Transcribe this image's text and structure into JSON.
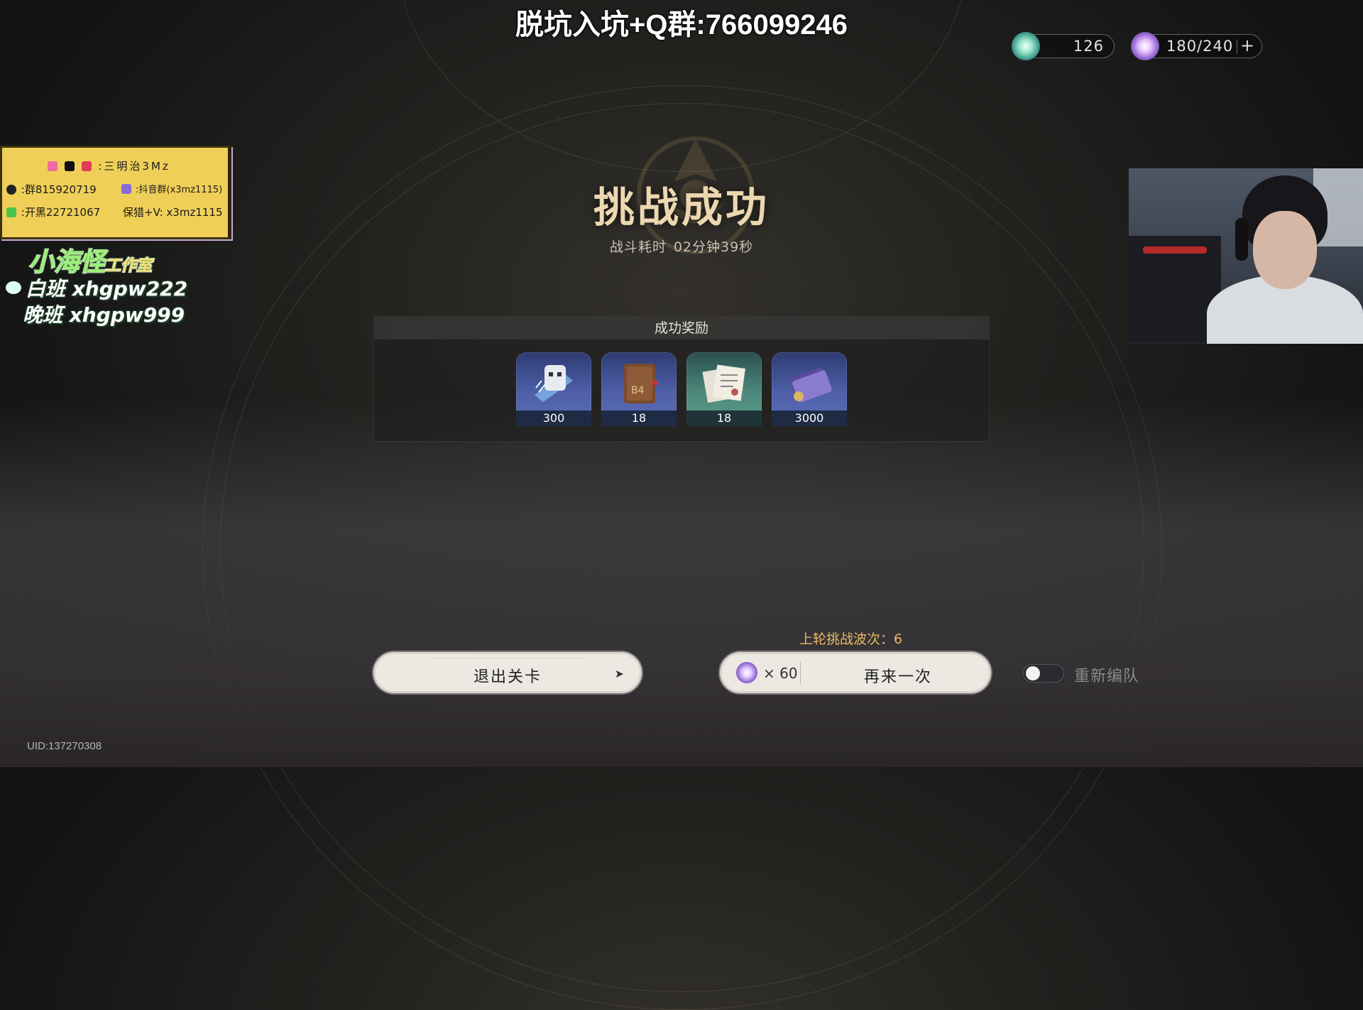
{
  "watermark": "脱坑入坑+Q群:766099246",
  "resources": {
    "fuel": {
      "icon": "stellar-jade-icon",
      "value": "126"
    },
    "power": {
      "icon": "trailblaze-power-icon",
      "value": "180/240",
      "add_label": "+"
    }
  },
  "stream_overlay": {
    "handle": ":三明治3Mz",
    "qq_group": ":群815920719",
    "fan_group": ":抖音群(x3mz1115)",
    "open_black": ":开黑22721067",
    "guarantee": "保猎+V: x3mz1115",
    "studio": "小海怪",
    "studio_suffix": "工作室",
    "day_shift": "白班  xhgpw222",
    "night_shift": "晚班  xhgpw999"
  },
  "result": {
    "title": "挑战成功",
    "time_label": "战斗耗时",
    "time_value": "02分钟39秒"
  },
  "rewards": {
    "header": "成功奖励",
    "items": [
      {
        "icon": "trace-material-icon",
        "count": "300"
      },
      {
        "icon": "adventure-log-icon",
        "count": "18"
      },
      {
        "icon": "travel-encounter-icon",
        "count": "18"
      },
      {
        "icon": "credit-card-icon",
        "count": "3000"
      }
    ]
  },
  "bottom": {
    "last_waves": "上轮挑战波次：6",
    "exit_label": "退出关卡",
    "cost": "× 60",
    "again_label": "再来一次",
    "reteam_label": "重新编队",
    "reteam_on": false
  },
  "uid": "UID:137270308"
}
